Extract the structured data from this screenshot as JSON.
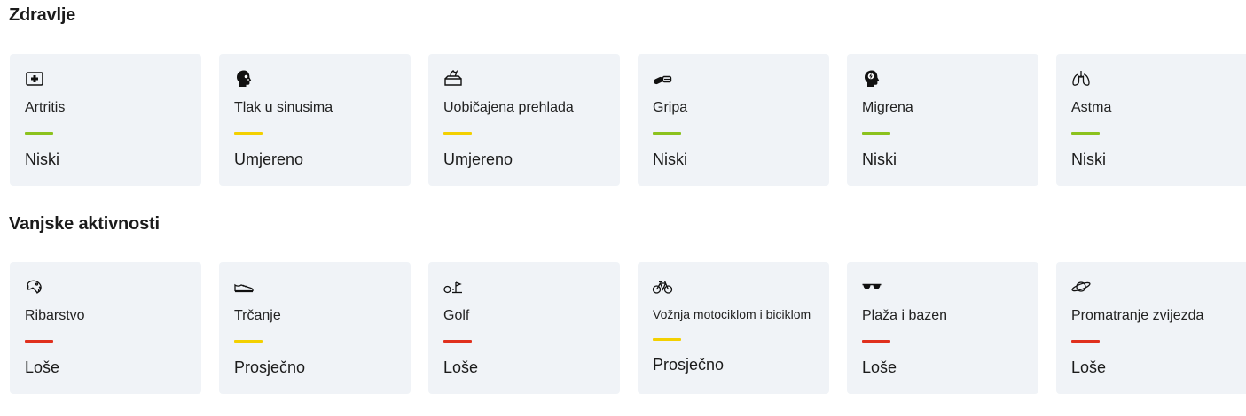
{
  "health": {
    "title": "Zdravlje",
    "cards": [
      {
        "label": "Artritis",
        "level": "Niski",
        "icon": "first-aid-icon",
        "color": "#8cc21e"
      },
      {
        "label": "Tlak u sinusima",
        "level": "Umjereno",
        "icon": "head-sinus-icon",
        "color": "#f3d000"
      },
      {
        "label": "Uobičajena prehlada",
        "level": "Umjereno",
        "icon": "tissue-box-icon",
        "color": "#f3d000"
      },
      {
        "label": "Gripa",
        "level": "Niski",
        "icon": "pills-icon",
        "color": "#8cc21e"
      },
      {
        "label": "Migrena",
        "level": "Niski",
        "icon": "head-migraine-icon",
        "color": "#8cc21e"
      },
      {
        "label": "Astma",
        "level": "Niski",
        "icon": "lungs-icon",
        "color": "#8cc21e"
      }
    ]
  },
  "outdoor": {
    "title": "Vanjske aktivnosti",
    "cards": [
      {
        "label": "Ribarstvo",
        "level": "Loše",
        "icon": "fish-icon",
        "color": "#e0301e"
      },
      {
        "label": "Trčanje",
        "level": "Prosječno",
        "icon": "running-shoe-icon",
        "color": "#f3d000"
      },
      {
        "label": "Golf",
        "level": "Loše",
        "icon": "golf-icon",
        "color": "#e0301e"
      },
      {
        "label": "Vožnja motociklom i biciklom",
        "level": "Prosječno",
        "icon": "bicycle-icon",
        "color": "#f3d000"
      },
      {
        "label": "Plaža i bazen",
        "level": "Loše",
        "icon": "sunglasses-icon",
        "color": "#e0301e"
      },
      {
        "label": "Promatranje zvijezda",
        "level": "Loše",
        "icon": "planet-icon",
        "color": "#e0301e"
      }
    ]
  }
}
